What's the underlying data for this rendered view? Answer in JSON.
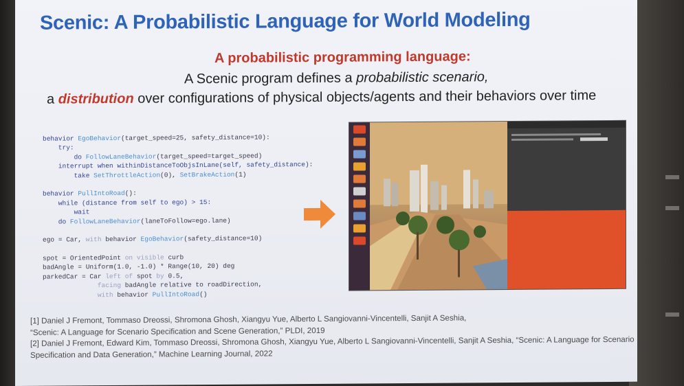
{
  "slide": {
    "title": "Scenic: A Probabilistic Language for World Modeling",
    "subtitle": "A probabilistic programming language:",
    "line2_prefix": "A Scenic program defines a ",
    "line2_em": "probabilistic scenario,",
    "line3_prefix": "a ",
    "line3_em": "distribution",
    "line3_suffix": " over configurations of physical objects/agents and their behaviors over time"
  },
  "code": {
    "l1a": "behavior ",
    "l1b": "EgoBehavior",
    "l1c": "(target_speed=25, safety_distance=10):",
    "l2": "    try:",
    "l3a": "        do ",
    "l3b": "FollowLaneBehavior",
    "l3c": "(target_speed=target_speed)",
    "l4": "    interrupt when withinDistanceToObjsInLane(self, safety_distance):",
    "l5a": "        take ",
    "l5b": "SetThrottleAction",
    "l5c": "(0), ",
    "l5d": "SetBrakeAction",
    "l5e": "(1)",
    "l6a": "behavior ",
    "l6b": "PullIntoRoad",
    "l6c": "():",
    "l7": "    while (distance from self to ego) > 15:",
    "l8": "        wait",
    "l9a": "    do ",
    "l9b": "FollowLaneBehavior",
    "l9c": "(laneToFollow=ego.lane)",
    "l10a": "ego = Car, ",
    "l10b": "with",
    "l10c": " behavior ",
    "l10d": "EgoBehavior",
    "l10e": "(safety_distance=10)",
    "l11a": "spot = OrientedPoint ",
    "l11b": "on visible",
    "l11c": " curb",
    "l12": "badAngle = Uniform(1.0, -1.0) * Range(10, 20) deg",
    "l13a": "parkedCar = Car ",
    "l13b": "left of",
    "l13c": " spot ",
    "l13d": "by",
    "l13e": " 0.5,",
    "l14a": "              ",
    "l14b": "facing",
    "l14c": " badAngle relative to roadDirection,",
    "l15a": "              ",
    "l15b": "with",
    "l15c": " behavior ",
    "l15d": "PullIntoRoad",
    "l15e": "()"
  },
  "references": {
    "r1a": "[1] Daniel J Fremont, Tommaso Dreossi, Shromona Ghosh, Xiangyu Yue, Alberto L Sangiovanni-Vincentelli, Sanjit A Seshia,",
    "r1b": "“Scenic: A Language for Scenario Specification and Scene Generation,” PLDI, 2019",
    "r2a": "[2] Daniel J Fremont, Edward Kim, Tommaso Dreossi, Shromona Ghosh, Xiangyu Yue, Alberto L Sangiovanni-Vincentelli, Sanjit A Seshia, “Scenic: A Language for Scenario",
    "r2b": "Specification and Data Generation,” Machine Learning Journal, 2022"
  },
  "colors": {
    "title": "#2e63b8",
    "accent_red": "#c0392b",
    "arrow": "#ee8a3a",
    "desktop_orange": "#e0512a"
  },
  "icons": [
    "arrow-right-icon"
  ]
}
